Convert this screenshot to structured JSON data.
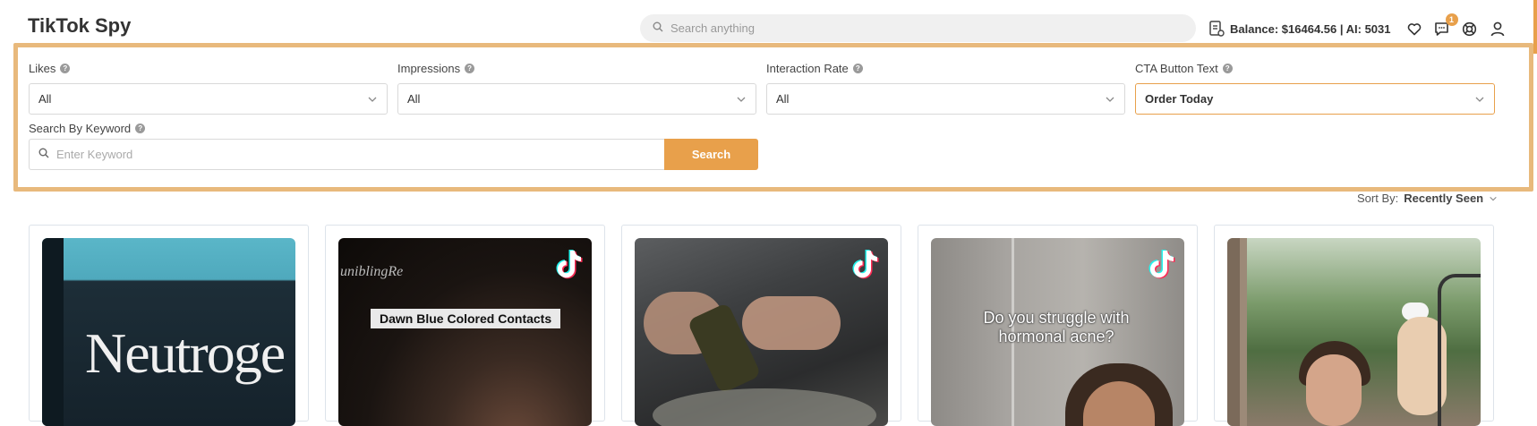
{
  "app": {
    "title": "TikTok Spy"
  },
  "header": {
    "search_placeholder": "Search anything",
    "balance": "Balance: $16464.56 | AI: 5031",
    "notification_count": "1"
  },
  "filters": {
    "likes": {
      "label": "Likes",
      "value": "All"
    },
    "impressions": {
      "label": "Impressions",
      "value": "All"
    },
    "interaction_rate": {
      "label": "Interaction Rate",
      "value": "All"
    },
    "cta_button_text": {
      "label": "CTA Button Text",
      "value": "Order Today"
    },
    "keyword": {
      "label": "Search By Keyword",
      "placeholder": "Enter Keyword",
      "button": "Search"
    }
  },
  "sort": {
    "label": "Sort By:",
    "value": "Recently Seen"
  },
  "cards": [
    {
      "overlay_text": "Neutroge"
    },
    {
      "overlay_text": "Dawn Blue Colored Contacts",
      "watermark": "uniblingRe"
    },
    {
      "overlay_text": ""
    },
    {
      "overlay_text": "Do you struggle with hormonal acne?"
    },
    {
      "overlay_text": ""
    }
  ],
  "colors": {
    "accent": "#e8a04b",
    "panel_border": "#e8b97c"
  }
}
